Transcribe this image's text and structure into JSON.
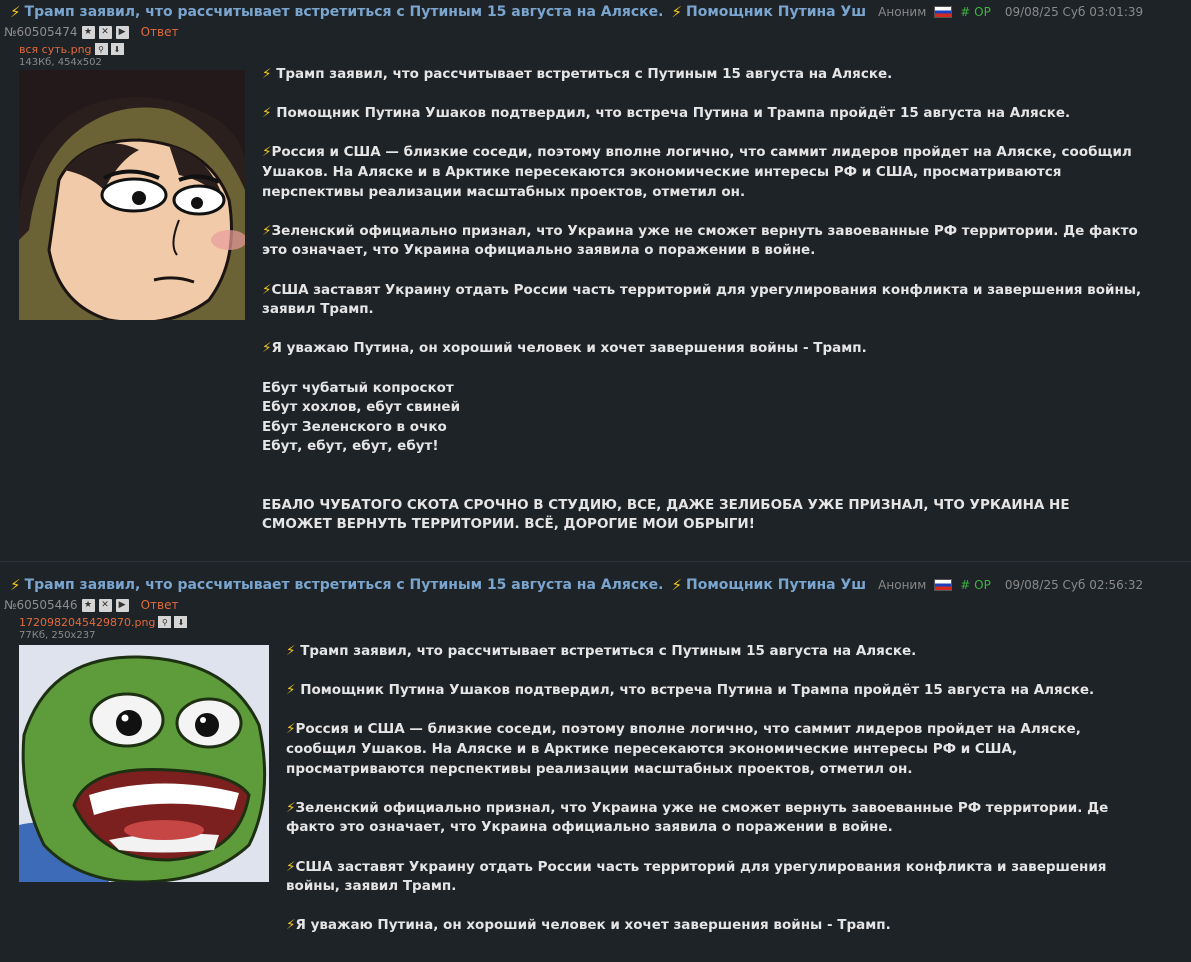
{
  "posts": [
    {
      "subject": "Трамп заявил, что рассчитывает встретиться с Путиным 15 августа на Аляске.",
      "subject_extra": "Помощник Путина Уш",
      "author": "Аноним",
      "op_label": "# OP",
      "date": "09/08/25 Суб 03:01:39",
      "number": "№60505474",
      "reply_label": "Ответ",
      "file_name": "вся суть.png",
      "file_meta": "143Кб, 454x502",
      "image_desc": "cartoon-boy-face",
      "text": {
        "p1": "Трамп заявил, что рассчитывает встретиться с Путиным 15 августа на Аляске.",
        "p2": "Помощник Путина Ушаков подтвердил, что встреча Путина и Трампа пройдёт 15 августа на Аляске.",
        "p3": "Россия и США — близкие соседи, поэтому вполне логично, что саммит лидеров пройдет на Аляске, сообщил Ушаков. На Аляске и в Арктике пересекаются экономические интересы РФ и США, просматриваются перспективы реализации масштабных проектов, отметил он.",
        "p4": "Зеленский официально признал, что Украина уже не сможет вернуть завоеванные РФ территории. Де факто это означает, что Украина официально заявила о поражении в войне.",
        "p5": "США заставят Украину отдать России часть территорий для урегулирования конфликта и завершения войны, заявил Трамп.",
        "p6": "Я уважаю Путина, он хороший человек и хочет завершения войны - Трамп.",
        "poem": [
          "Ебут чубатый копроскот",
          "Ебут хохлов, ебут свиней",
          "Ебут Зеленского в очко",
          "Ебут, ебут, ебут, ебут!"
        ],
        "final": "ЕБАЛО ЧУБАТОГО СКОТА СРОЧНО В СТУДИЮ, ВСЕ, ДАЖЕ ЗЕЛИБОБА УЖЕ ПРИЗНАЛ, ЧТО УРКАИНА НЕ СМОЖЕТ ВЕРНУТЬ ТЕРРИТОРИИ. ВСЁ, ДОРОГИЕ МОИ ОБРЫГИ!"
      }
    },
    {
      "subject": "Трамп заявил, что рассчитывает встретиться с Путиным 15 августа на Аляске.",
      "subject_extra": "Помощник Путина Уш",
      "author": "Аноним",
      "op_label": "# OP",
      "date": "09/08/25 Суб 02:56:32",
      "number": "№60505446",
      "reply_label": "Ответ",
      "file_name": "1720982045429870.png",
      "file_meta": "77Кб, 250x237",
      "image_desc": "pepe-frog-laughing",
      "text": {
        "p1": "Трамп заявил, что рассчитывает встретиться с Путиным 15 августа на Аляске.",
        "p2": "Помощник Путина Ушаков подтвердил, что встреча Путина и Трампа пройдёт 15 августа на Аляске.",
        "p3": "Россия и США — близкие соседи, поэтому вполне логично, что саммит лидеров пройдет на Аляске, сообщил Ушаков. На Аляске и в Арктике пересекаются экономические интересы РФ и США, просматриваются перспективы реализации масштабных проектов, отметил он.",
        "p4": "Зеленский официально признал, что Украина уже не сможет вернуть завоеванные РФ территории. Де факто это означает, что Украина официально заявила о поражении в войне.",
        "p5": "США заставят Украину отдать России часть территорий для урегулирования конфликта и завершения войны, заявил Трамп.",
        "p6": "Я уважаю Путина, он хороший человек и хочет завершения войны - Трамп."
      }
    }
  ],
  "bolt": "⚡",
  "colors": {
    "background": "#1e2328",
    "subject": "#7aa5ce",
    "reply": "#e36a3a",
    "op": "#3fb23f",
    "bolt": "#f0c419"
  }
}
